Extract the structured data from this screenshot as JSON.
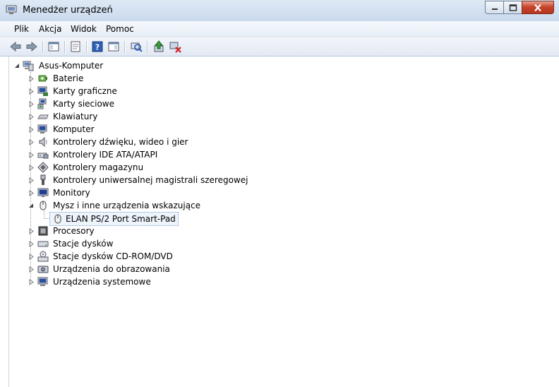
{
  "window": {
    "title": "Menedżer urządzeń"
  },
  "menu": {
    "items": [
      "Plik",
      "Akcja",
      "Widok",
      "Pomoc"
    ]
  },
  "toolbar": {
    "buttons": [
      "back-icon",
      "forward-icon",
      "show-hide-console-tree-icon",
      "properties-icon",
      "help-icon",
      "action-pane-icon",
      "scan-hardware-icon",
      "update-driver-icon",
      "uninstall-icon"
    ]
  },
  "tree": {
    "root": "Asus-Komputer",
    "categories": [
      "Baterie",
      "Karty graficzne",
      "Karty sieciowe",
      "Klawiatury",
      "Komputer",
      "Kontrolery dźwięku, wideo i gier",
      "Kontrolery IDE ATA/ATAPI",
      "Kontrolery magazynu",
      "Kontrolery uniwersalnej magistrali szeregowej",
      "Monitory",
      "Mysz i inne urządzenia wskazujące",
      "Procesory",
      "Stacje dysków",
      "Stacje dysków CD-ROM/DVD",
      "Urządzenia do obrazowania",
      "Urządzenia systemowe"
    ],
    "expanded_child": "ELAN PS/2 Port Smart-Pad"
  },
  "colors": {
    "titlebar": "#dfe9f5",
    "close_button": "#c7452c",
    "selection": "#eef4fb"
  }
}
